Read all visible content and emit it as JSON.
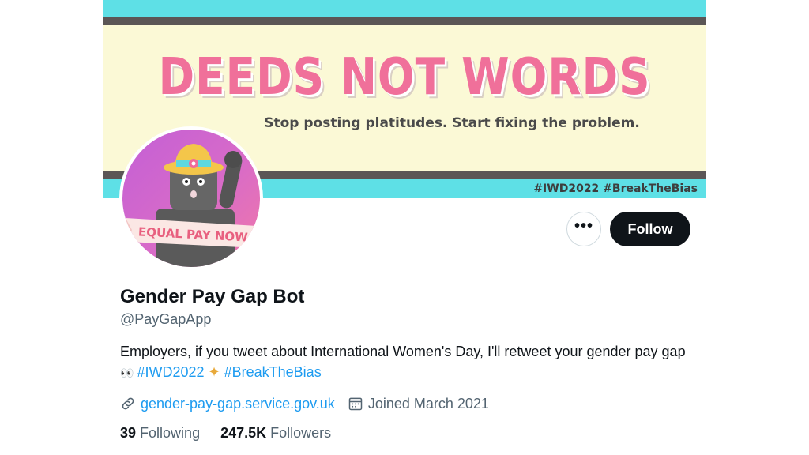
{
  "banner": {
    "headline": "DEEDS NOT WORDS",
    "subline": "Stop posting platitudes. Start fixing the problem.",
    "tags": "#IWD2022 #BreakTheBias"
  },
  "avatar": {
    "ribbon_text": "EQUAL PAY NOW"
  },
  "actions": {
    "more_label": "•••",
    "follow_label": "Follow"
  },
  "profile": {
    "name": "Gender Pay Gap Bot",
    "handle": "@PayGapApp",
    "bio_text": "Employers, if you tweet about International Women's Day, I'll retweet your gender pay gap",
    "bio_emoji": "👀",
    "bio_tag1": "#IWD2022",
    "bio_sparkle": "✦",
    "bio_tag2": "#BreakTheBias",
    "website": "gender-pay-gap.service.gov.uk",
    "joined": "Joined March 2021"
  },
  "stats": {
    "following_count": "39",
    "following_label": "Following",
    "followers_count": "247.5K",
    "followers_label": "Followers"
  },
  "colors": {
    "accent": "#1d9bf0",
    "banner_pink": "#f0709a",
    "banner_cyan": "#5ee0e6",
    "banner_cream": "#fbf9d6"
  }
}
